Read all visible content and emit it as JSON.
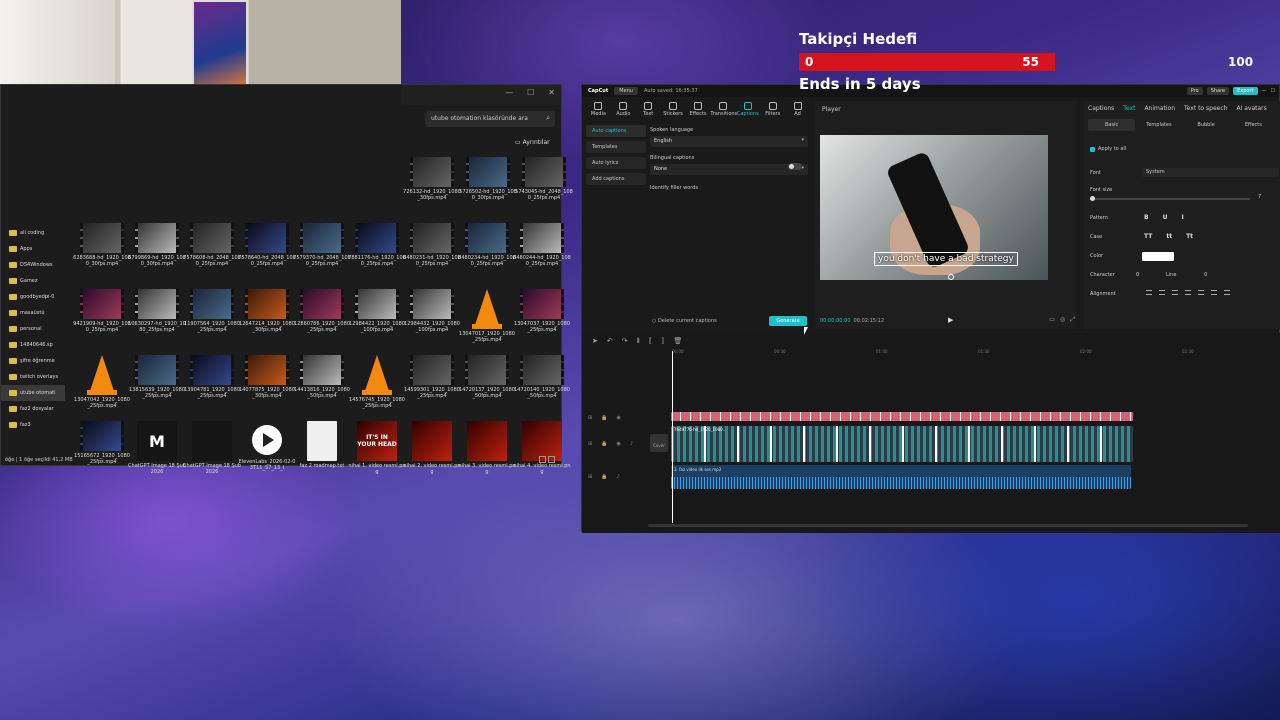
{
  "overlay": {
    "title": "Takipçi Hedefi",
    "start": "0",
    "current": "55",
    "goal": "100",
    "progress": 0.55,
    "ends": "Ends in 5 days"
  },
  "explorer": {
    "search_placeholder": "utube otomation klasöründe ara",
    "details_label": "Ayrıntılar",
    "status": "öğe  |  1 öğe seçildi  41,2 MB",
    "sidebar": [
      "all coding",
      "Apps",
      "DS4Windows",
      "Gamez",
      "goodbyedpi-0",
      "masaüstü",
      "personal",
      "14840646.sp",
      "şifre öğrenme",
      "twitch overlays",
      "utube otomati",
      "faz2 dosyalar",
      "faz3"
    ],
    "files": [
      {
        "name": "6283688-hd_1920_1080_30fps.mp4",
        "kind": "video",
        "tone": "t1"
      },
      {
        "name": "6799869-hd_1920_1080_30fps.mp4",
        "kind": "video",
        "tone": "t4"
      },
      {
        "name": "7578608-hd_2048_1080_25fps.mp4",
        "kind": "video",
        "tone": "t1"
      },
      {
        "name": "7578640-hd_2048_1080_25fps.mp4",
        "kind": "video",
        "tone": "t5"
      },
      {
        "name": "7579370-hd_2048_1080_25fps.mp4",
        "kind": "video",
        "tone": "t2"
      },
      {
        "name": "7881176-hd_1920_1080_25fps.mp4",
        "kind": "video",
        "tone": "t5"
      },
      {
        "name": "8480231-hd_1920_1080_25fps.mp4",
        "kind": "video",
        "tone": "t1"
      },
      {
        "name": "8480234-hd_1920_1080_25fps.mp4",
        "kind": "video",
        "tone": "t2"
      },
      {
        "name": "8480244-hd_1920_1080_25fps.mp4",
        "kind": "video",
        "tone": "t4"
      },
      {
        "name": "9421909-hd_1920_1080_25fps.mp4",
        "kind": "video",
        "tone": "t6"
      },
      {
        "name": "10630297-hd_1920_1080_25fps.mp4",
        "kind": "video",
        "tone": "t4"
      },
      {
        "name": "11907564_1920_1080_25fps.mp4",
        "kind": "video",
        "tone": "t2"
      },
      {
        "name": "12647214_1920_1080_30fps.mp4",
        "kind": "video",
        "tone": "t3"
      },
      {
        "name": "12860786_1920_1080_25fps.mp4",
        "kind": "video",
        "tone": "t6"
      },
      {
        "name": "12984422_1920_1080_100fps.mp4",
        "kind": "video",
        "tone": "t4"
      },
      {
        "name": "12984432_1920_1080_100fps.mp4",
        "kind": "video",
        "tone": "t4"
      },
      {
        "name": "13047017_1920_1080_25fps.mp4",
        "kind": "vlc"
      },
      {
        "name": "13047037_1920_1080_25fps.mp4",
        "kind": "video",
        "tone": "t6"
      },
      {
        "name": "13047042_1920_1080_25fps.mp4",
        "kind": "vlc"
      },
      {
        "name": "13815639_1920_1080_25fps.mp4",
        "kind": "video",
        "tone": "t2"
      },
      {
        "name": "13904781_1920_1080_25fps.mp4",
        "kind": "video",
        "tone": "t5"
      },
      {
        "name": "14077875_1920_1080_30fps.mp4",
        "kind": "video",
        "tone": "t3"
      },
      {
        "name": "14413816_1920_1080_50fps.mp4",
        "kind": "video",
        "tone": "t4"
      },
      {
        "name": "14576745_1920_1080_25fps.mp4",
        "kind": "vlc"
      },
      {
        "name": "14599301_1920_1080_25fps.mp4",
        "kind": "video",
        "tone": "t1"
      },
      {
        "name": "14720137_1920_1080_50fps.mp4",
        "kind": "video",
        "tone": "t1"
      },
      {
        "name": "14720140_1920_1080_50fps.mp4",
        "kind": "video",
        "tone": "t1"
      },
      {
        "name": "15165672_1920_1080_25fps.mp4",
        "kind": "video",
        "tone": "t5"
      },
      {
        "name": "ChatGPT Image 18 Şub 2026",
        "kind": "png",
        "glyph": "M",
        "sub": "mecalimeni"
      },
      {
        "name": "ChatGPT Image 18 Şub 2026",
        "kind": "png",
        "glyph": ""
      },
      {
        "name": "ElevenLabs_2026-02-03T11_57_13_I",
        "kind": "audio"
      },
      {
        "name": "faz 2 roadmap.txt",
        "kind": "doc"
      },
      {
        "name": "nihai 1. video resmi.png",
        "kind": "yt",
        "glyph": "IT'S IN YOUR HEAD"
      },
      {
        "name": "nihai 2. video resmi.png",
        "kind": "yt",
        "glyph": ""
      },
      {
        "name": "nihai 3. video resmi.png",
        "kind": "yt",
        "glyph": ""
      },
      {
        "name": "nihai 4. video resmi.png",
        "kind": "yt",
        "glyph": ""
      }
    ],
    "partial_row": [
      "726132-hd_1920_1080_30fps.mp4",
      "5726502-hd_1920_1080_30fps.mp4",
      "5743045-hd_2048_1080_25fps.mp4"
    ]
  },
  "capcut": {
    "logo": "CapCut",
    "menu": "Menu",
    "saved": "Auto saved: 16:35:37",
    "pro": "Pro",
    "share": "Share",
    "export": "Export",
    "tools": [
      "Media",
      "Audio",
      "Text",
      "Stickers",
      "Effects",
      "Transitions",
      "Captions",
      "Filters",
      "Ad"
    ],
    "active_tool": "Captions",
    "left_buttons": [
      "Auto captions",
      "Templates",
      "Auto lyrics",
      "Add captions"
    ],
    "spoken_label": "Spoken language",
    "spoken_value": "English",
    "bilingual_label": "Bilingual captions",
    "bilingual_value": "None",
    "filler_label": "Identify filler words",
    "delete_label": "Delete current captions",
    "generate": "Generate",
    "player_title": "Player",
    "caption_text": "you don't have a bad strategy",
    "time_current": "00:00:00:00",
    "time_total": "00:02:15:12",
    "right_tabs": [
      "Captions",
      "Text",
      "Animation",
      "Text to speech",
      "AI avatars"
    ],
    "right_active": "Text",
    "sub_tabs": [
      "Basic",
      "Templates",
      "Bubble",
      "Effects"
    ],
    "apply_all": "Apply to all",
    "font_label": "Font",
    "font_value": "System",
    "fontsize_label": "Font size",
    "fontsize_value": "7",
    "pattern_label": "Pattern",
    "case_label": "Case",
    "color_label": "Color",
    "character_label": "Character",
    "character_value": "0",
    "line_label": "Line",
    "line_value": "0",
    "alignment_label": "Alignment",
    "ruler": [
      "00:00",
      "00:30",
      "01:00",
      "01:30",
      "02:00",
      "02:30"
    ],
    "video_clip_name": "7649776-hd_1920_1080...",
    "audio_clip_name": "3. faz video ilk ses.mp3",
    "cover": "Cover"
  }
}
